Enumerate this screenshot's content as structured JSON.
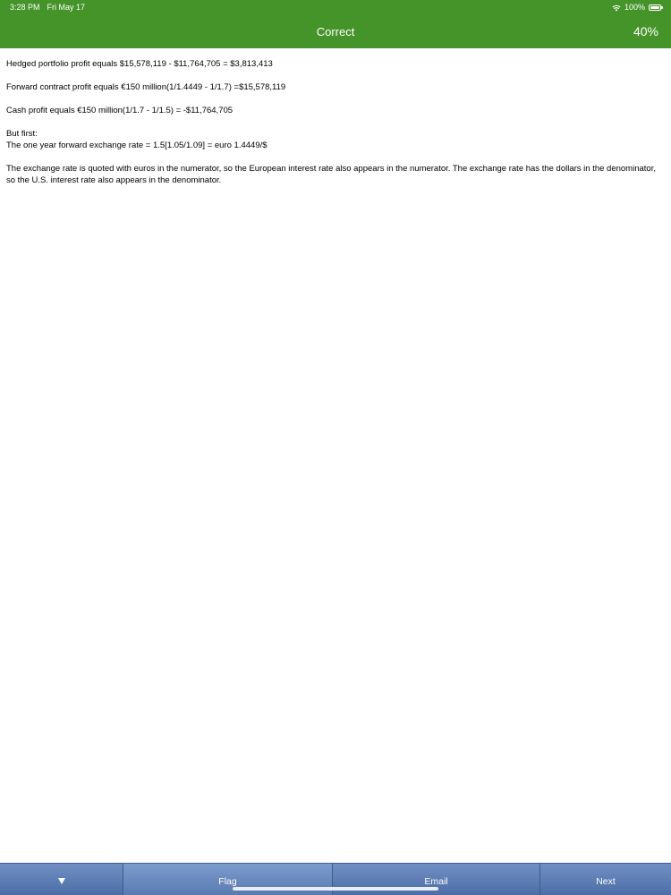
{
  "status_bar": {
    "time": "3:28 PM",
    "date": "Fri May 17",
    "battery": "100%",
    "wifi_icon": "wifi-icon",
    "battery_icon": "battery-icon"
  },
  "nav": {
    "title": "Correct",
    "score": "40%",
    "color": "#45942a"
  },
  "explanation": {
    "line1": "Hedged portfolio profit equals $15,578,119 - $11,764,705 = $3,813,413",
    "line2": "Forward contract profit equals €150 million(1/1.4449 - 1/1.7) =$15,578,119",
    "line3": "Cash profit equals €150 million(1/1.7 - 1/1.5) = -$11,764,705",
    "line4a": "But first:",
    "line4b": "The one year forward exchange rate = 1.5[1.05/1.09] = euro 1.4449/$",
    "line5": "The exchange rate is quoted with euros in the numerator, so the European interest rate also appears in the numerator. The exchange rate has the dollars in the denominator, so the U.S. interest rate also appears in the denominator."
  },
  "toolbar": {
    "collapse_icon": "chevron-down-icon",
    "flag_label": "Flag",
    "email_label": "Email",
    "next_label": "Next",
    "color": "#5a7bb2"
  }
}
